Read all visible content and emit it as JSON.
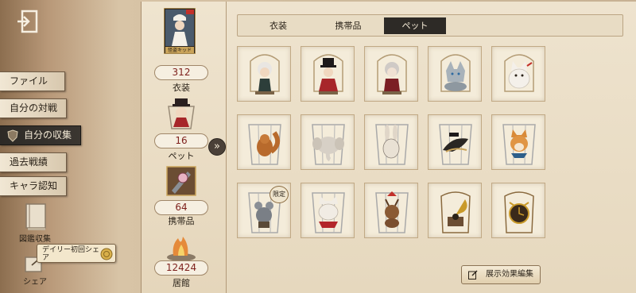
{
  "left_nav": {
    "items": [
      {
        "label": "ファイル",
        "active": false
      },
      {
        "label": "自分の対戦",
        "active": false
      },
      {
        "label": "自分の収集",
        "active": true
      },
      {
        "label": "過去戦績",
        "active": false
      },
      {
        "label": "キャラ認知",
        "active": false
      }
    ],
    "encyclopedia_label": "図鑑収集",
    "share_label": "シェア",
    "share_tooltip": "デイリー初回シェア"
  },
  "summary": {
    "costume": {
      "count": "312",
      "label": "衣装",
      "thumb_caption": "怪盗キッド"
    },
    "pet": {
      "count": "16",
      "label": "ペット"
    },
    "item": {
      "count": "64",
      "label": "携帯品"
    },
    "residence": {
      "count": "12424",
      "label": "居館"
    }
  },
  "tabs": [
    {
      "label": "衣装",
      "active": false
    },
    {
      "label": "携帯品",
      "active": false
    },
    {
      "label": "ペット",
      "active": true
    }
  ],
  "pets": [
    {
      "icon": "pet-white-haired-doll"
    },
    {
      "icon": "pet-top-hat-doll"
    },
    {
      "icon": "pet-silver-doll"
    },
    {
      "icon": "pet-silver-wolf"
    },
    {
      "icon": "pet-white-fox"
    },
    {
      "icon": "pet-squirrel"
    },
    {
      "icon": "pet-elephant"
    },
    {
      "icon": "pet-rabbit"
    },
    {
      "icon": "pet-crow"
    },
    {
      "icon": "pet-shiba-dog"
    },
    {
      "icon": "pet-armored-mouse",
      "badge": "限定"
    },
    {
      "icon": "pet-white-cat"
    },
    {
      "icon": "pet-reindeer"
    },
    {
      "icon": "pet-gramophone"
    },
    {
      "icon": "pet-golden-clock"
    }
  ],
  "edit_button": "展示効果編集",
  "colors": {
    "active_tab": "#2d2a26",
    "count_text": "#7d1f1b",
    "panel_bg": "#eee3ce"
  }
}
